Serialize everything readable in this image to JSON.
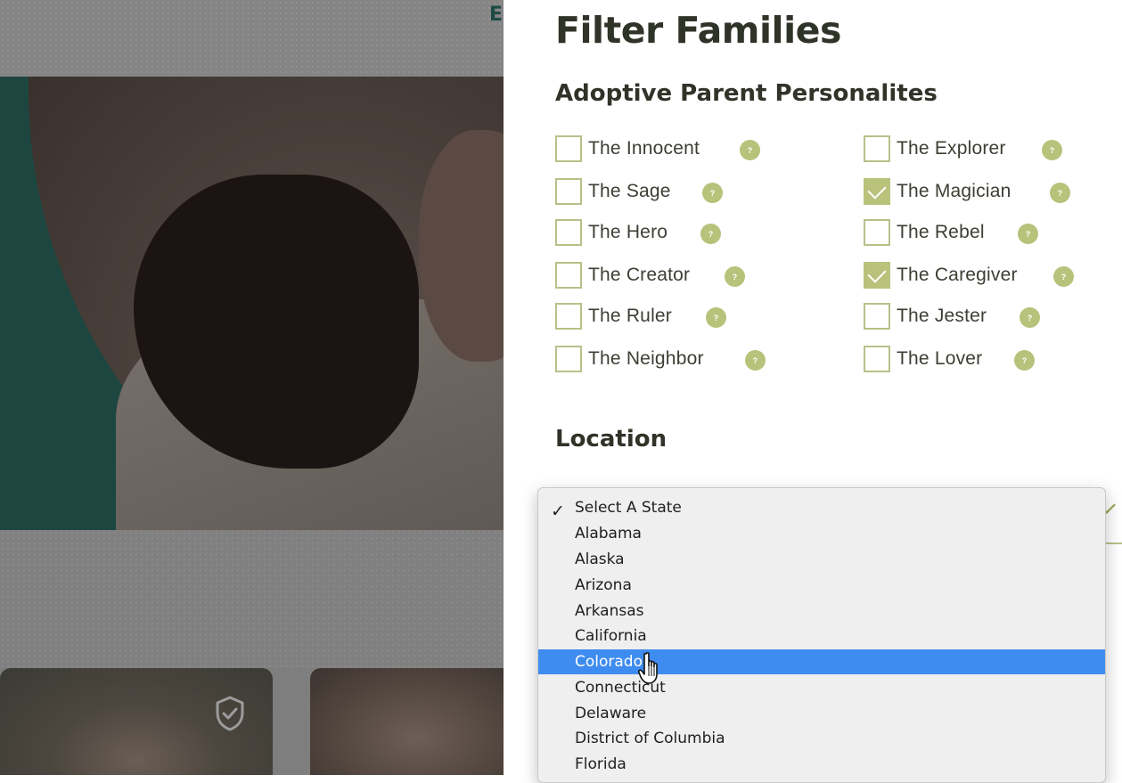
{
  "background_page": {
    "header_letter": "E"
  },
  "filter_panel": {
    "title": "Filter Families",
    "personalities": {
      "title": "Adoptive Parent Personalites",
      "help_glyph": "?",
      "left_column": [
        {
          "label": "The Innocent",
          "checked": false
        },
        {
          "label": "The Sage",
          "checked": false
        },
        {
          "label": "The Hero",
          "checked": false
        },
        {
          "label": "The Creator",
          "checked": false
        },
        {
          "label": "The Ruler",
          "checked": false
        },
        {
          "label": "The Neighbor",
          "checked": false
        }
      ],
      "right_column": [
        {
          "label": "The Explorer",
          "checked": false
        },
        {
          "label": "The Magician",
          "checked": true
        },
        {
          "label": "The Rebel",
          "checked": false
        },
        {
          "label": "The Caregiver",
          "checked": true
        },
        {
          "label": "The Jester",
          "checked": false
        },
        {
          "label": "The Lover",
          "checked": false
        }
      ]
    },
    "location": {
      "title": "Location",
      "state_select": {
        "selected": "Select A State",
        "highlighted": "Colorado",
        "options": [
          "Select A State",
          "Alabama",
          "Alaska",
          "Arizona",
          "Arkansas",
          "California",
          "Colorado",
          "Connecticut",
          "Delaware",
          "District of Columbia",
          "Florida"
        ]
      }
    }
  },
  "colors": {
    "accent_green": "#b7c27a",
    "heading_text": "#2f3328",
    "dropdown_highlight": "#3f8cf0"
  },
  "icons": {
    "selected_check": "checkmark-icon",
    "help": "help-icon",
    "cursor": "pointer-hand-icon",
    "card_badge": "shield-check-icon"
  }
}
